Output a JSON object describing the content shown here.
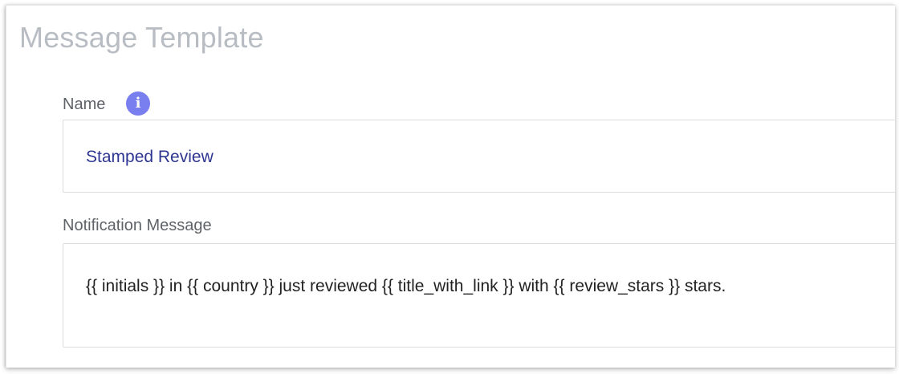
{
  "panel": {
    "title": "Message Template"
  },
  "name_field": {
    "label": "Name",
    "info_icon": "info-icon",
    "info_glyph": "i",
    "value": "Stamped Review"
  },
  "notification_field": {
    "label": "Notification Message",
    "value": "{{ initials }} in {{ country }} just reviewed {{ title_with_link }} with {{ review_stars }} stars."
  },
  "colors": {
    "title": "#b8bcc3",
    "label": "#5f6368",
    "info_icon_bg": "#7a7ff0",
    "name_value": "#2f3692",
    "message_value": "#222222",
    "input_border": "#dcdcdc"
  }
}
